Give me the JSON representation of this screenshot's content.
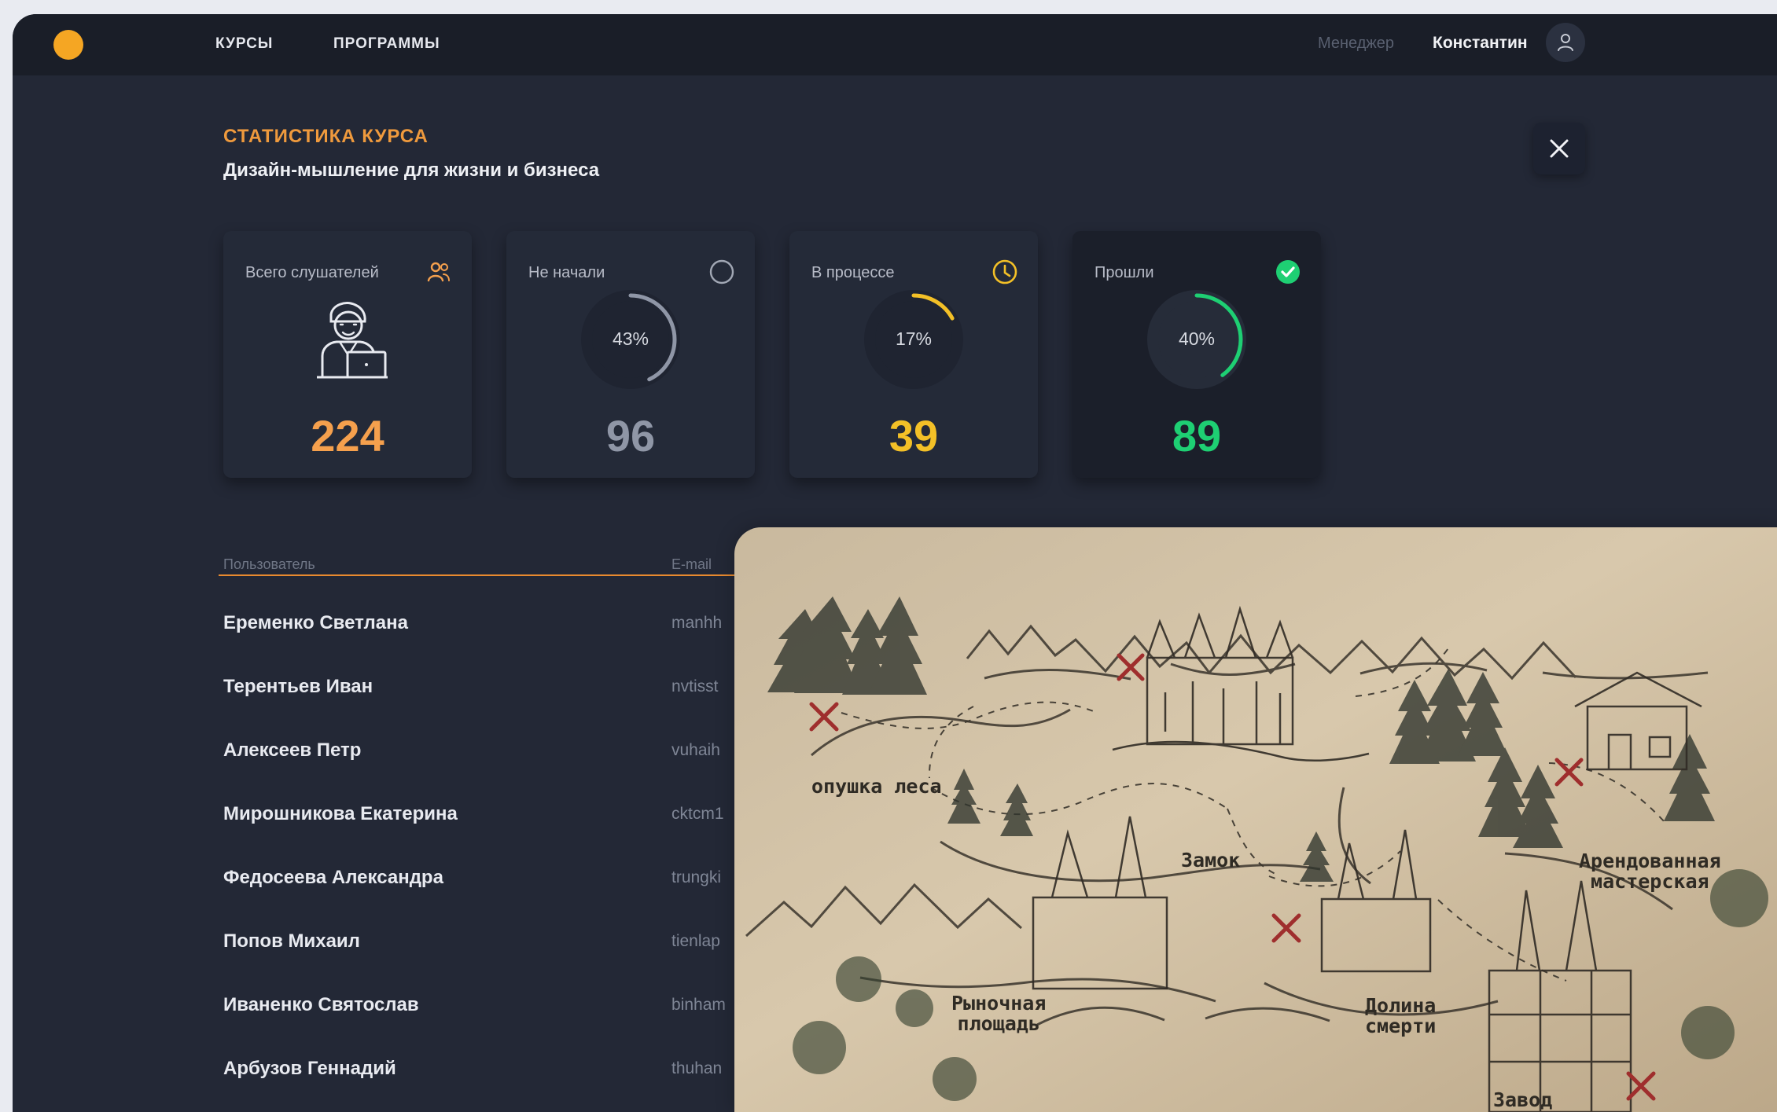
{
  "navigation": {
    "courses": "КУРСЫ",
    "programs": "ПРОГРАММЫ",
    "role": "Менеджер",
    "user_name": "Константин"
  },
  "course": {
    "section_label": "СТАТИСТИКА КУРСА",
    "title": "Дизайн-мышление для жизни и бизнеса"
  },
  "stats": [
    {
      "label": "Всего слушателей",
      "value": "224",
      "icon": "people-icon",
      "color": "#F5A04D"
    },
    {
      "label": "Не начали",
      "value": "96",
      "percent_text": "43%",
      "percent": 43,
      "icon": "empty-circle-icon",
      "color": "#8F96A6"
    },
    {
      "label": "В процессе",
      "value": "39",
      "percent_text": "17%",
      "percent": 17,
      "icon": "clock-icon",
      "color": "#F3C027"
    },
    {
      "label": "Прошли",
      "value": "89",
      "percent_text": "40%",
      "percent": 40,
      "icon": "check-circle-icon",
      "color": "#1ECF73"
    }
  ],
  "table": {
    "headers": {
      "user": "Пользователь",
      "email": "E-mail"
    },
    "rows": [
      {
        "name": "Еременко Светлана",
        "email": "manhh"
      },
      {
        "name": "Терентьев Иван",
        "email": "nvtisst"
      },
      {
        "name": "Алексеев Петр",
        "email": "vuhaih"
      },
      {
        "name": "Мирошникова Екатерина",
        "email": "cktcm1"
      },
      {
        "name": "Федосеева Александра",
        "email": "trungki"
      },
      {
        "name": "Попов Михаил",
        "email": "tienlap"
      },
      {
        "name": "Иваненко Святослав",
        "email": "binham"
      },
      {
        "name": "Арбузов Геннадий",
        "email": "thuhan"
      }
    ]
  },
  "map": {
    "labels": [
      "опушка леса",
      "Замок",
      "Арендованная\nмастерская",
      "Рыночная\nплощадь",
      "Долина\nсмерти",
      "Завод"
    ]
  }
}
